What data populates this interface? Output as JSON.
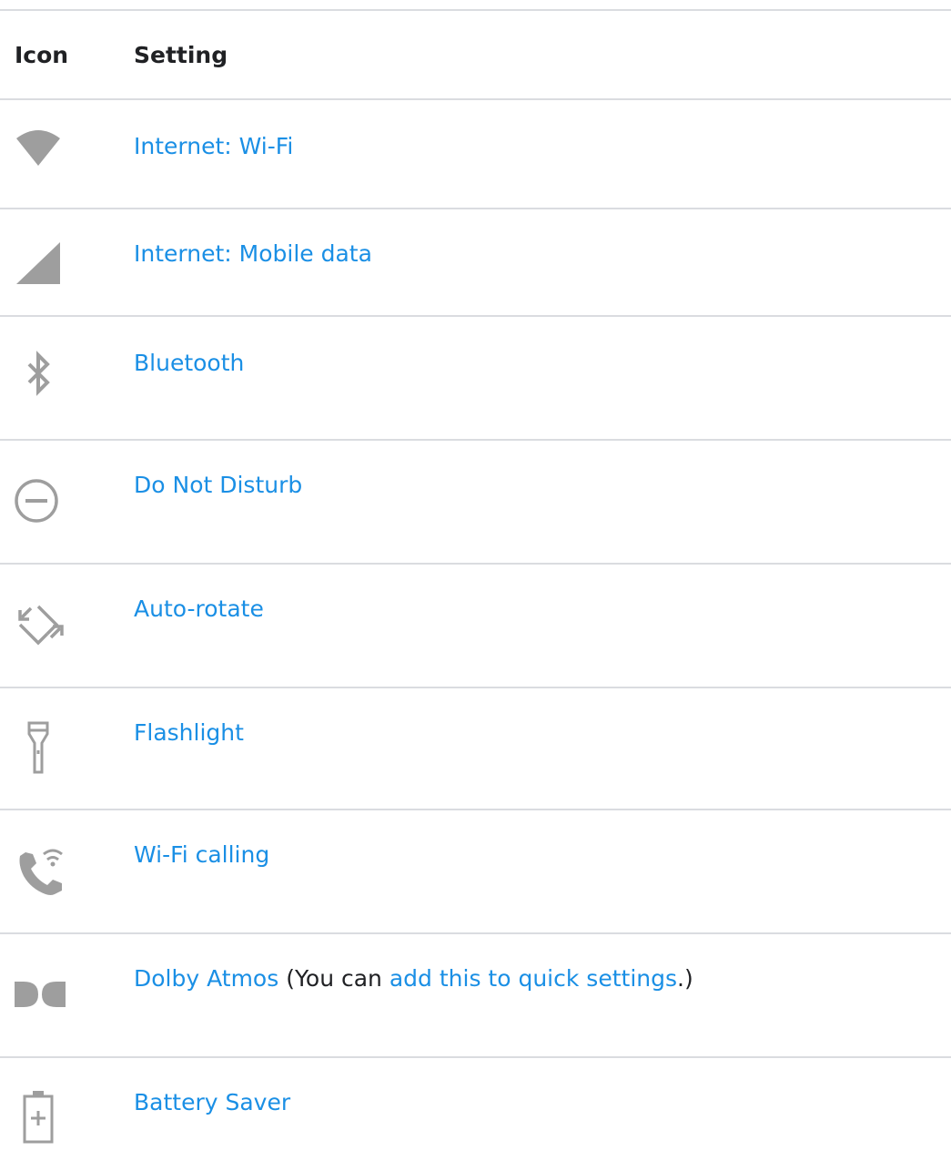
{
  "header": {
    "icon_col": "Icon",
    "setting_col": "Setting"
  },
  "rows": [
    {
      "icon": "wifi-icon",
      "link": "Internet: Wi-Fi"
    },
    {
      "icon": "mobile-signal-icon",
      "link": "Internet: Mobile data"
    },
    {
      "icon": "bluetooth-icon",
      "link": "Bluetooth"
    },
    {
      "icon": "do-not-disturb-icon",
      "link": "Do Not Disturb"
    },
    {
      "icon": "auto-rotate-icon",
      "link": "Auto-rotate"
    },
    {
      "icon": "flashlight-icon",
      "link": "Flashlight"
    },
    {
      "icon": "wifi-calling-icon",
      "link": "Wi-Fi calling"
    },
    {
      "icon": "dolby-icon",
      "link": "Dolby Atmos",
      "text_before": " (You can ",
      "inline_link": "add this to quick settings",
      "text_after": ".)"
    },
    {
      "icon": "battery-saver-icon",
      "link": "Battery Saver"
    }
  ],
  "colors": {
    "link": "#1a8fe5",
    "icon_gray": "#9e9e9e",
    "divider": "#dadce0"
  }
}
